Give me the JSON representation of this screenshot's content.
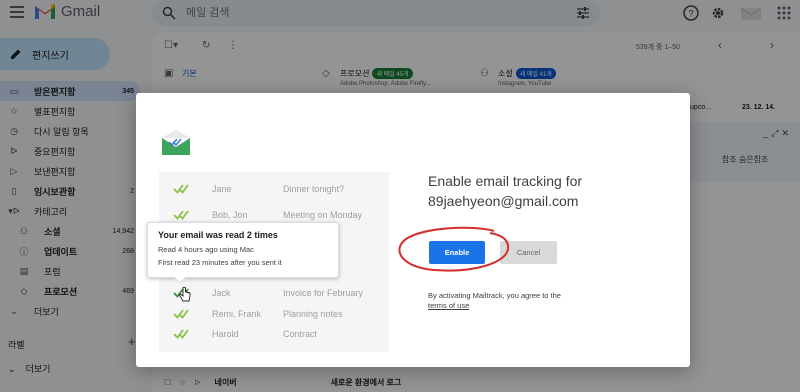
{
  "header": {
    "app_name": "Gmail",
    "search_placeholder": "메일 검색"
  },
  "compose_label": "편지쓰기",
  "nav": [
    {
      "label": "받은편지함",
      "count": "345",
      "icon": "inbox-icon",
      "glyph": "▭",
      "active": true
    },
    {
      "label": "별표편지함",
      "count": "",
      "icon": "star-icon",
      "glyph": "☆"
    },
    {
      "label": "다시 알림 항목",
      "count": "",
      "icon": "clock-icon",
      "glyph": "◷"
    },
    {
      "label": "중요편지함",
      "count": "",
      "icon": "important-icon",
      "glyph": "ᐅ"
    },
    {
      "label": "보낸편지함",
      "count": "",
      "icon": "send-icon",
      "glyph": "▷"
    },
    {
      "label": "임시보관함",
      "count": "2",
      "icon": "draft-icon",
      "glyph": "▯",
      "bold": true
    },
    {
      "label": "카테고리",
      "count": "",
      "icon": "category-icon",
      "glyph": "▾ᐅ"
    },
    {
      "label": "소셜",
      "count": "14,942",
      "icon": "social-icon",
      "glyph": "⚇",
      "sub": true,
      "bold": true
    },
    {
      "label": "업데이트",
      "count": "268",
      "icon": "info-icon",
      "glyph": "ⓘ",
      "sub": true,
      "bold": true
    },
    {
      "label": "포럼",
      "count": "",
      "icon": "forum-icon",
      "glyph": "▤",
      "sub": true
    },
    {
      "label": "프로모션",
      "count": "469",
      "icon": "tag-icon",
      "glyph": "◇",
      "sub": true,
      "bold": true
    },
    {
      "label": "더보기",
      "count": "",
      "icon": "chevron-down-icon",
      "glyph": "⌄"
    }
  ],
  "labels_heading": "라벨",
  "more_label": "더보기",
  "mail_toolbar": {
    "pager": "539개 중 1–50"
  },
  "tabs": [
    {
      "name": "기본",
      "badge": "",
      "sub": "",
      "icon": "inbox-tab-icon"
    },
    {
      "name": "프로모션",
      "badge": "새 메일 45개",
      "sub": "Adobe Photoshop, Adobe Firefly...",
      "icon": "tag-tab-icon"
    },
    {
      "name": "소셜",
      "badge": "새 메일 41개",
      "sub": "Instagram, YouTube",
      "icon": "people-tab-icon"
    }
  ],
  "bg_row": {
    "snippet": "upco...",
    "date": "23. 12. 14."
  },
  "side_panel_text": "참조 숨은참조",
  "bottom_row": {
    "sender": "네이버",
    "subject": "새로운 환경에서 로그"
  },
  "modal": {
    "heading_line1": "Enable email tracking for",
    "heading_line2": "89jaehyeon@gmail.com",
    "enable_label": "Enable",
    "cancel_label": "Cancel",
    "terms_prefix": "By activating Mailtrack, you agree to the",
    "terms_link": "terms of use",
    "preview_rows": [
      {
        "name": "Jane",
        "subject": "Dinner tonight?"
      },
      {
        "name": "Bob, Jon",
        "subject": "Meeting on Monday"
      },
      {
        "name": "",
        "subject": "go"
      },
      {
        "name": "",
        "subject": "pe"
      },
      {
        "name": "",
        "subject": "oject"
      },
      {
        "name": "Jack",
        "subject": "Invoice for February"
      },
      {
        "name": "Remi, Frank",
        "subject": "Planning notes"
      },
      {
        "name": "Harold",
        "subject": "Contract"
      }
    ],
    "tooltip": {
      "title": "Your email was read 2 times",
      "line1": "Read 4 hours ago using Mac",
      "line2": "First read 23 minutes after you sent it"
    }
  },
  "colors": {
    "enable_blue": "#1a73e8",
    "check_green": "#4caf50",
    "annotation_red": "#d32f2f",
    "mailtrack_green": "#3ba55c"
  }
}
